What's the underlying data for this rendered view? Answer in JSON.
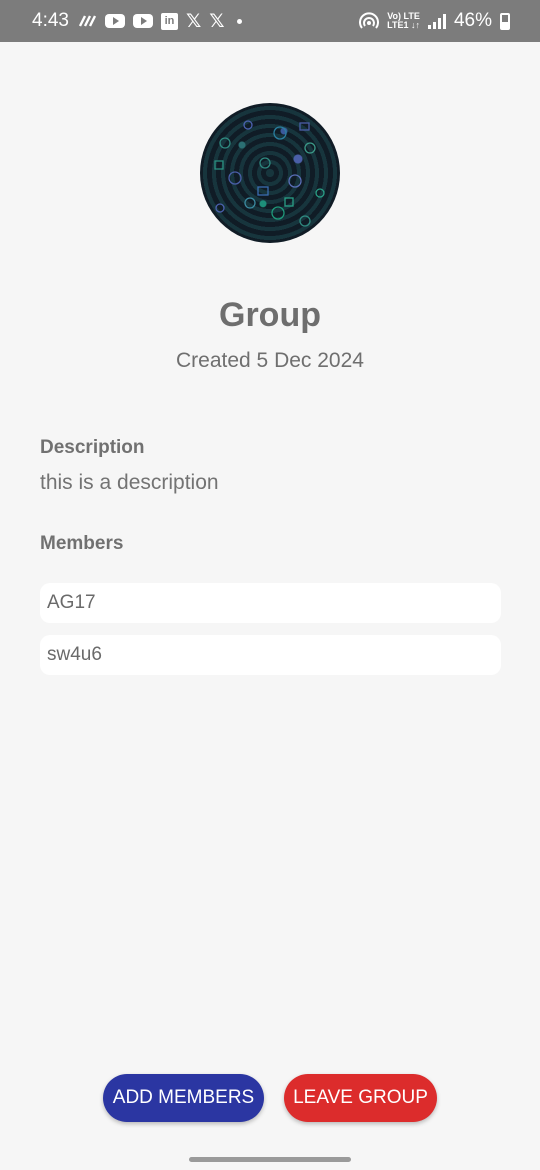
{
  "status_bar": {
    "time": "4:43",
    "battery": "46%",
    "network_top": "Vo) LTE",
    "network_bottom": "LTE1 ↓↑",
    "icons": [
      "wifi-calling-icon",
      "youtube-icon",
      "youtube-icon",
      "linkedin-icon",
      "x-icon",
      "x-icon",
      "notification-dot-icon",
      "hotspot-icon",
      "signal-icon",
      "battery-icon"
    ]
  },
  "group": {
    "name": "Group",
    "created": "Created 5 Dec 2024",
    "avatar": "group-avatar-image"
  },
  "description": {
    "label": "Description",
    "text": "this is a description"
  },
  "members": {
    "label": "Members",
    "items": [
      "AG17",
      "sw4u6"
    ]
  },
  "actions": {
    "add_members": "ADD MEMBERS",
    "leave_group": "LEAVE GROUP",
    "add_color": "#2b36a2",
    "leave_color": "#dc2c2c"
  }
}
